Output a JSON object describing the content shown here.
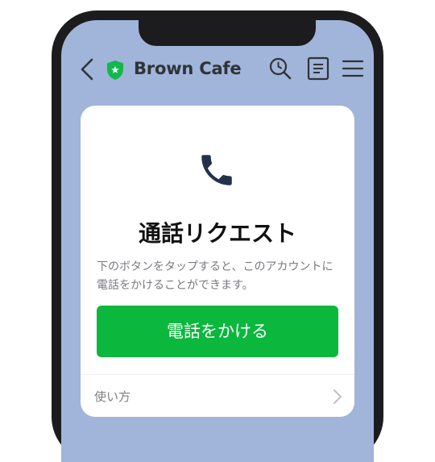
{
  "header": {
    "title": "Brown Cafe",
    "back_icon": "chevron-left-icon",
    "badge_icon": "verified-shield-icon",
    "actions": [
      "search-icon",
      "notes-icon",
      "menu-icon"
    ]
  },
  "card": {
    "icon": "phone-icon",
    "title": "通話リクエスト",
    "description": "下のボタンをタップすると、このアカウントに電話をかけることができます。",
    "call_button_label": "電話をかける",
    "howto_label": "使い方",
    "howto_icon": "chevron-right-icon"
  },
  "colors": {
    "chat_background": "#a1b4d9",
    "accent_green": "#0bb73d",
    "shield_green": "#12b84a"
  }
}
